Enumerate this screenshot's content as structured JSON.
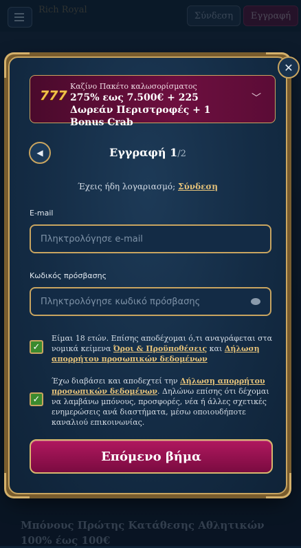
{
  "header": {
    "logo_text": "Rich Royal",
    "login_label": "Σύνδεση",
    "signup_label": "Εγγραφή"
  },
  "background": {
    "promo_title": "Μπόνους Πρώτης Κατάθεσης Αθλητικών 100% έως 100€"
  },
  "modal": {
    "promo": {
      "icon_text": "777",
      "subtitle": "Καζίνο Πακέτο καλωσορίσματος",
      "title": "275% εως 7.500€ + 225 Δωρεάν Περιστροφές + 1 Bonus Crab"
    },
    "step": {
      "title": "Εγγραφή 1",
      "total": "/2"
    },
    "have_account": {
      "text": "Έχεις ήδη λογαριασμό;",
      "link": "Σύνδεση"
    },
    "email": {
      "label": "E-mail",
      "placeholder": "Πληκτρολόγησε e-mail",
      "value": ""
    },
    "password": {
      "label": "Κωδικός πρόσβασης",
      "placeholder": "Πληκτρολόγησε κωδικό πρόσβασης",
      "value": ""
    },
    "terms": {
      "checked": true,
      "text_before": "Είμαι 18 ετών. Επίσης αποδέχομαι ό,τι αναγράφεται στα νομικά κείμενα",
      "link1": "Όροι & Προϋποθέσεις",
      "and": "και",
      "link2": "Δήλωση απορρήτου προσωπικών δεδομένων"
    },
    "privacy": {
      "checked": true,
      "text_before": "Έχω διαβάσει και αποδεχτεί την",
      "link": "Δήλωση απορρήτου προσωπικών δεδομένων",
      "text_after": ". Δηλώνω επίσης ότι δέχομαι να λαμβάνω μπόνους, προσφορές, νέα ή άλλες σχετικές ενημερώσεις ανά διαστήματα, μέσω οποιουδήποτε καναλιού επικοινωνίας."
    },
    "next_label": "Επόμενο βήμα"
  },
  "colors": {
    "accent_gold": "#c9a560",
    "button_magenta": "#9a1453",
    "checkbox_green": "#3b8a2e",
    "modal_bg": "#142c45"
  },
  "icons": [
    "menu-icon",
    "close-icon",
    "slot-777-icon",
    "chevron-down-icon",
    "back-arrow-icon",
    "eye-icon",
    "checkmark-icon"
  ]
}
